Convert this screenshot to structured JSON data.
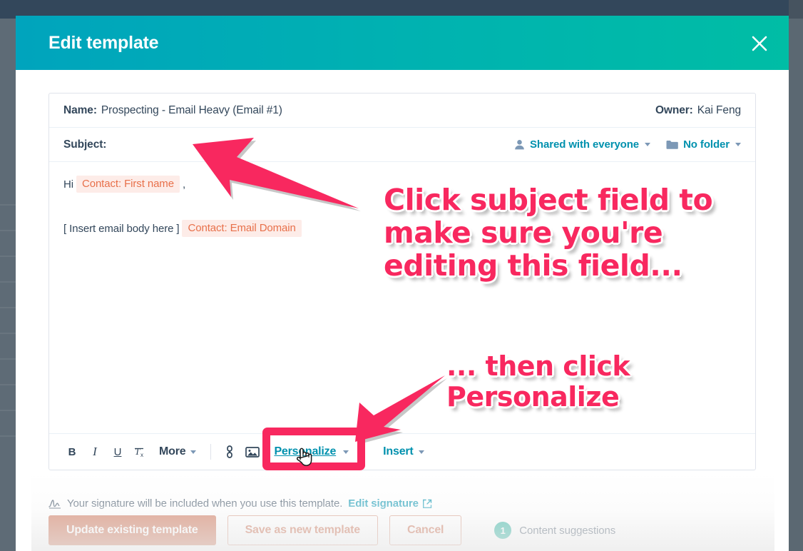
{
  "modal": {
    "title": "Edit template",
    "close_icon": "close-icon"
  },
  "template": {
    "name_label": "Name:",
    "name_value": "Prospecting - Email Heavy (Email #1)",
    "owner_label": "Owner:",
    "owner_value": "Kai Feng",
    "subject_label": "Subject:",
    "subject_value": "",
    "sharing": {
      "icon": "person-icon",
      "label": "Shared with everyone",
      "caret": "chevron-down-icon"
    },
    "folder": {
      "icon": "folder-icon",
      "label": "No folder",
      "caret": "chevron-down-icon"
    }
  },
  "body": {
    "greeting_prefix": "Hi",
    "greeting_token": "Contact: First name",
    "greeting_suffix": ",",
    "line2_prefix": "[ Insert email body here ]",
    "line2_token": "Contact: Email Domain"
  },
  "toolbar": {
    "bold": "B",
    "italic": "I",
    "underline": "U",
    "clear_format": "Tx",
    "more": "More",
    "link_icon": "link-icon",
    "image_icon": "image-icon",
    "personalize": "Personalize",
    "insert": "Insert"
  },
  "signature": {
    "icon": "signature-icon",
    "text": "Your signature will be included when you use this template.",
    "link": "Edit signature",
    "external_icon": "external-link-icon"
  },
  "footer": {
    "update_button": "Update existing template",
    "save_new_button": "Save as new template",
    "cancel_button": "Cancel",
    "suggestions_count": "1",
    "suggestions_label": "Content suggestions"
  },
  "annotations": {
    "note_1": "Click subject field to make sure you're editing this field...",
    "note_2": "... then click Personalize",
    "color": "#f8285f",
    "highlight_target": "Personalize",
    "cursor_icon": "hand-pointer-cursor"
  },
  "colors": {
    "header_gradient_start": "#00a4bd",
    "header_gradient_end": "#00bda5",
    "link": "#0091ae",
    "token_bg": "#fdece8",
    "token_text": "#e8704a",
    "primary_button": "#c2522e",
    "badge_green": "#00a38d",
    "annotation_pink": "#f8285f"
  }
}
